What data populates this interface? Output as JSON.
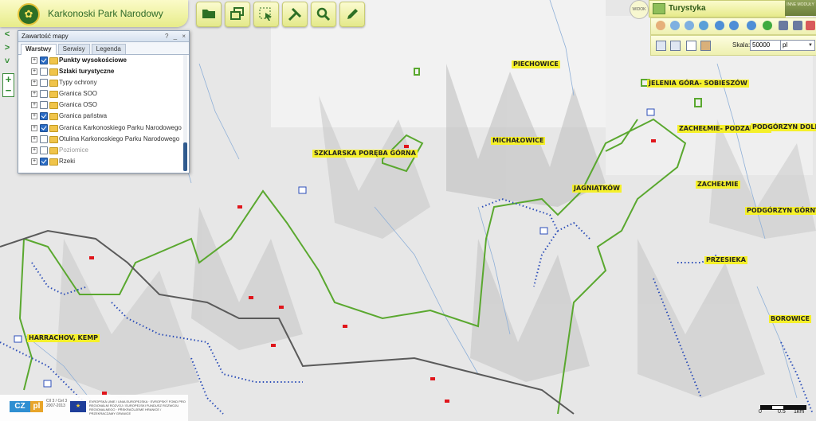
{
  "app": {
    "title": "Karkonoski Park Narodowy"
  },
  "toolbar": {
    "buttons": [
      "folder-open-icon",
      "windows-icon",
      "select-icon",
      "tools-icon",
      "search-icon",
      "pencil-icon"
    ]
  },
  "layer_panel": {
    "title": "Zawartość mapy",
    "help": "?",
    "minimize": "_",
    "close": "×",
    "tabs": [
      "Warstwy",
      "Serwisy",
      "Legenda"
    ],
    "layers": [
      {
        "label": "Punkty wysokościowe",
        "checked": true,
        "bold": true
      },
      {
        "label": "Szlaki turystyczne",
        "checked": false,
        "bold": true
      },
      {
        "label": "Typy ochrony",
        "checked": false,
        "bold": false
      },
      {
        "label": "Granica SOO",
        "checked": false,
        "bold": false
      },
      {
        "label": "Granica OSO",
        "checked": false,
        "bold": false
      },
      {
        "label": "Granica państwa",
        "checked": true,
        "bold": false
      },
      {
        "label": "Granica Karkonoskiego Parku Narodowego",
        "checked": true,
        "bold": false
      },
      {
        "label": "Otulina Karkonoskiego Parku Narodowego",
        "checked": false,
        "bold": false
      },
      {
        "label": "Poziomice",
        "checked": false,
        "bold": false,
        "dim": true
      },
      {
        "label": "Rzeki",
        "checked": true,
        "bold": false
      }
    ]
  },
  "modules": {
    "widok": "WIDOK",
    "active": "Turystyka",
    "inne": "INNE MODUŁY"
  },
  "scale": {
    "label": "Skala:",
    "value": "50000",
    "lang": "pl"
  },
  "places": [
    {
      "name": "PIECHOWICE"
    },
    {
      "name": "JELENIA GÓRA- SOBIESZÓW"
    },
    {
      "name": "ZACHEŁMIE- PODZAMCZE"
    },
    {
      "name": "PODGÓRZYN DOLNY"
    },
    {
      "name": "SZKLARSKA PORĘBA GÓRNA"
    },
    {
      "name": "MICHAŁOWICE"
    },
    {
      "name": "JAGNIĄTKÓW"
    },
    {
      "name": "ZACHEŁMIE"
    },
    {
      "name": "PODGÓRZYN GÓRNY"
    },
    {
      "name": "PRZESIEKA"
    },
    {
      "name": "BOROWICE"
    },
    {
      "name": "HARRACHOV, KEMP"
    }
  ],
  "footer": {
    "cz": "CZ",
    "pl": "pl",
    "years": "Cíl 3 / Cel 3\n2007-2013",
    "eu_text": "EVROPSKÁ UNIE / UNIA EUROPEJSKA · EVROPSKÝ FOND PRO REGIONÁLNÍ ROZVOJ / EUROPEJSKI FUNDUSZ ROZWOJU REGIONALNEGO · PŘEKRAČUJEME HRANICE / PRZEKRACZAMY GRANICE"
  },
  "scalebar": {
    "t0": "0",
    "t1": "0.5",
    "t2": "1km"
  },
  "colors": {
    "park_boundary": "#5aa82f",
    "country_border": "#5a5a5a",
    "trail": "#2b4db8",
    "label_bg": "#f5f02a",
    "ui_accent": "#e4e98a"
  }
}
